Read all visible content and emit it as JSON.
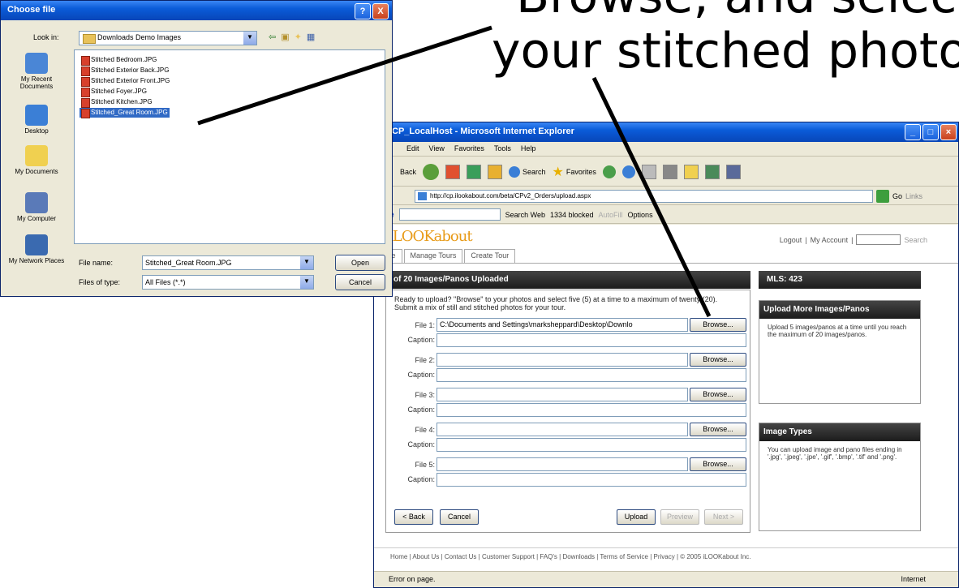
{
  "caption": {
    "line1": "Browse, and select",
    "line2": "your stitched photo"
  },
  "dialog": {
    "title": "Choose file",
    "look_in_label": "Look in:",
    "look_in_value": "Downloads Demo Images",
    "places": [
      "My Recent Documents",
      "Desktop",
      "My Documents",
      "My Computer",
      "My Network Places"
    ],
    "files": [
      "Stitched Bedroom.JPG",
      "Stitched Exterior Back.JPG",
      "Stitched Exterior Front.JPG",
      "Stitched Foyer.JPG",
      "Stitched Kitchen.JPG",
      "Stitched_Great Room.JPG"
    ],
    "selected_file": "Stitched_Great Room.JPG",
    "file_name_label": "File name:",
    "file_name_value": "Stitched_Great Room.JPG",
    "files_of_type_label": "Files of type:",
    "files_of_type_value": "All Files (*.*)",
    "open_label": "Open",
    "cancel_label": "Cancel",
    "help_label": "?",
    "close_label": "X"
  },
  "ie": {
    "title": "CP_LocalHost - Microsoft Internet Explorer",
    "menu": [
      "Edit",
      "View",
      "Favorites",
      "Tools",
      "Help"
    ],
    "toolbar": {
      "back": "Back",
      "search": "Search",
      "favorites": "Favorites"
    },
    "address": "http://cp.ilookabout.com/beta/CPv2_Orders/upload.aspx",
    "go_label": "Go",
    "links_label": "Links",
    "google": {
      "logo": "ogle",
      "search_web": "Search Web",
      "blocked": "1334 blocked",
      "autofill": "AutoFill",
      "options": "Options"
    },
    "page": {
      "logo": "iLOOKabout",
      "logout": "Logout",
      "my_account": "My Account",
      "search_label": "Search",
      "tabs": [
        "me",
        "Manage Tours",
        "Create Tour"
      ],
      "upload_header": "of 20 Images/Panos Uploaded",
      "intro": "Ready to upload? \"Browse\" to your photos and select five (5) at a time to a maximum of twenty (20). Submit a mix of still and stitched photos for your tour.",
      "files": [
        {
          "label": "File 1:",
          "value": "C:\\Documents and Settings\\marksheppard\\Desktop\\Downlo"
        },
        {
          "label": "File 2:",
          "value": ""
        },
        {
          "label": "File 3:",
          "value": ""
        },
        {
          "label": "File 4:",
          "value": ""
        },
        {
          "label": "File 5:",
          "value": ""
        }
      ],
      "caption_label": "Caption:",
      "browse_label": "Browse...",
      "back_label": "< Back",
      "cancel_label": "Cancel",
      "upload_label": "Upload",
      "preview_label": "Preview",
      "next_label": "Next >",
      "mls_header": "MLS: 423",
      "upload_more_header": "Upload More Images/Panos",
      "upload_more_body": "Upload 5 images/panos at a time until you reach the maximum of 20 images/panos.",
      "image_types_header": "Image Types",
      "image_types_body": "You can upload image and pano files ending in '.jpg', '.jpeg', '.jpe', '.gif', '.bmp', '.tif' and '.png'.",
      "footer": "Home | About Us | Contact Us | Customer Support | FAQ's | Downloads | Terms of Service | Privacy | © 2005 iLOOKabout Inc."
    },
    "status": {
      "left": "Error on page.",
      "zone": "Internet"
    }
  },
  "colors": {
    "xp_blue": "#0a5bd8",
    "logo_orange": "#e89a16",
    "panel_dark": "#1c1c1c"
  }
}
